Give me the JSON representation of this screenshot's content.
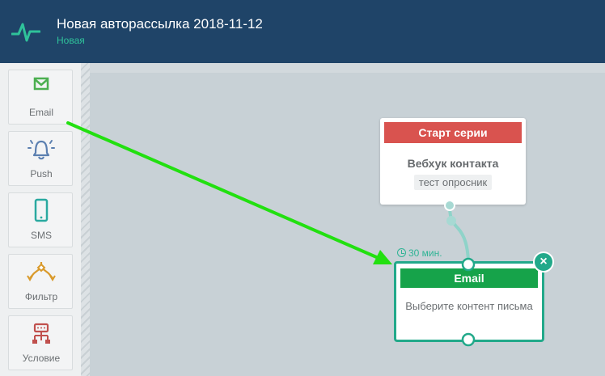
{
  "header": {
    "title": "Новая авторассылка 2018-11-12",
    "status": "Новая",
    "logo_icon": "pulse-icon"
  },
  "sidebar": {
    "tools": [
      {
        "label": "Email",
        "icon": "envelope-icon",
        "color": "#4caf50"
      },
      {
        "label": "Push",
        "icon": "bell-icon",
        "color": "#5b7fb0"
      },
      {
        "label": "SMS",
        "icon": "phone-icon",
        "color": "#2aa9a0"
      },
      {
        "label": "Фильтр",
        "icon": "filter-icon",
        "color": "#d99a2b"
      },
      {
        "label": "Условие",
        "icon": "condition-icon",
        "color": "#c0504d"
      }
    ]
  },
  "flow": {
    "start_node": {
      "header": "Старт серии",
      "trigger": "Вебхук контакта",
      "tag": "тест опросник"
    },
    "delay_label": "30 мин.",
    "email_node": {
      "header": "Email",
      "body": "Выберите контент письма"
    }
  },
  "colors": {
    "header_bg": "#1f4468",
    "accent": "#22a98a",
    "start_red": "#d9534f",
    "email_green": "#16a34a",
    "arrow": "#22e010"
  }
}
